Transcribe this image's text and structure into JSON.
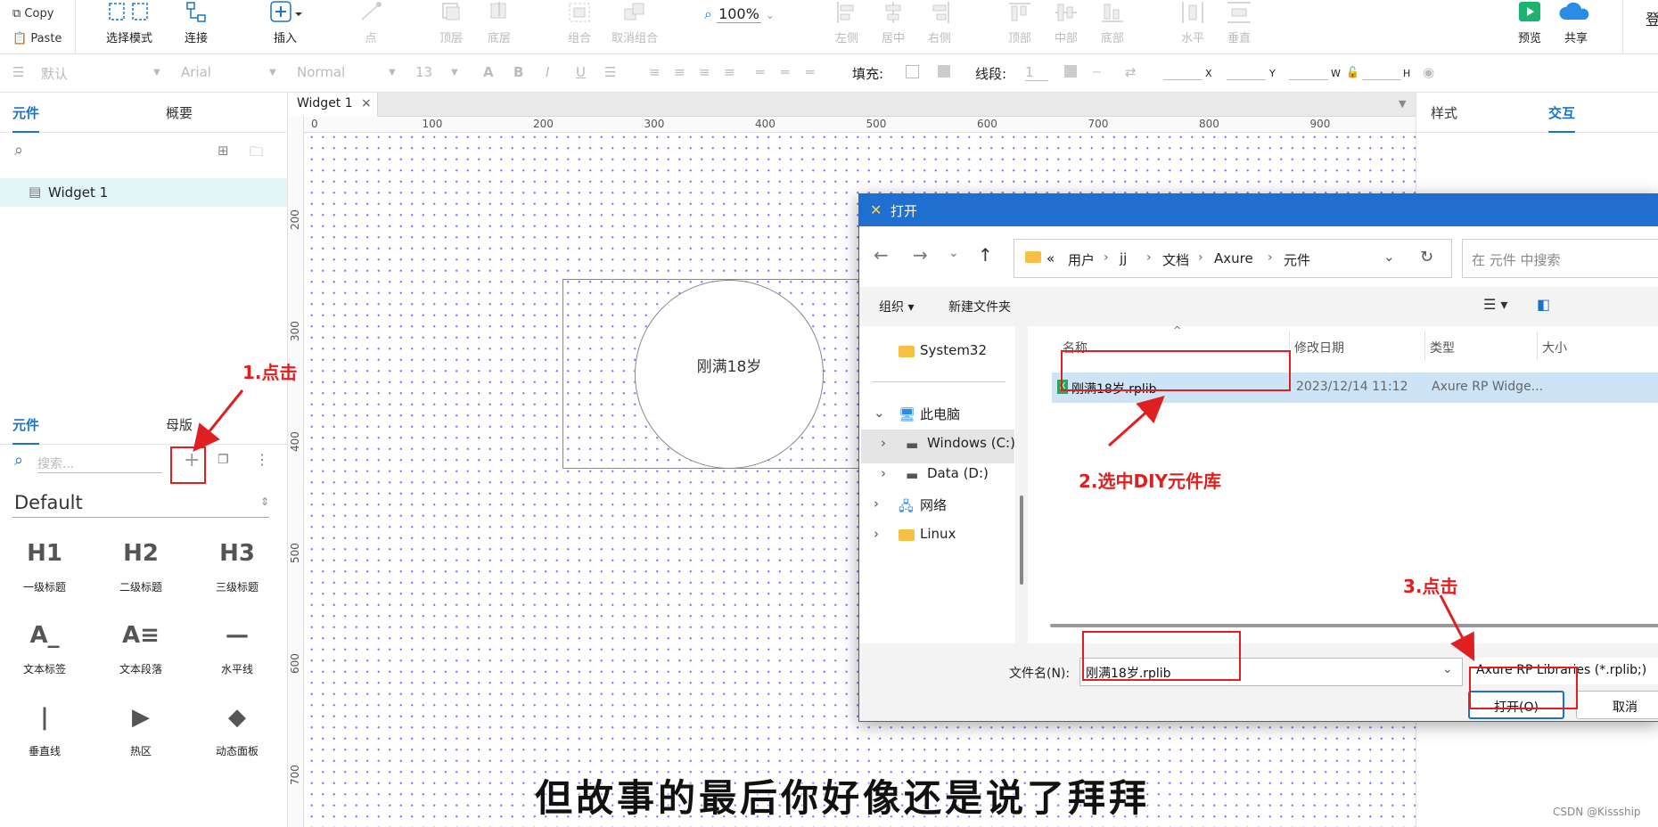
{
  "toolbar": {
    "copy": "Copy",
    "paste": "Paste",
    "items": [
      "选择模式",
      "连接",
      "插入",
      "点",
      "顶层",
      "底层",
      "组合",
      "取消组合",
      "左侧",
      "居中",
      "右侧",
      "顶部",
      "中部",
      "底部",
      "水平",
      "垂直",
      "预览",
      "共享",
      "登"
    ],
    "zoom": "100%"
  },
  "formatbar": {
    "style_default": "默认",
    "font": "Arial",
    "weight": "Normal",
    "size": "13",
    "fill_label": "填充:",
    "line_label": "线段:",
    "line_value": "1",
    "coords": [
      "X",
      "Y",
      "W",
      "H"
    ]
  },
  "left_panel": {
    "top_tabs": [
      "元件",
      "概要"
    ],
    "pages": [
      "Widget 1"
    ],
    "bottom_tabs": [
      "元件",
      "母版"
    ],
    "search_placeholder": "搜索...",
    "library": "Default",
    "widgets": [
      {
        "icon": "H1",
        "label": "一级标题"
      },
      {
        "icon": "H2",
        "label": "二级标题"
      },
      {
        "icon": "H3",
        "label": "三级标题"
      },
      {
        "icon": "A_",
        "label": "文本标签"
      },
      {
        "icon": "A≡",
        "label": "文本段落"
      },
      {
        "icon": "—",
        "label": "水平线"
      },
      {
        "icon": "|",
        "label": "垂直线"
      },
      {
        "icon": "▶",
        "label": "热区"
      },
      {
        "icon": "◆",
        "label": "动态面板"
      }
    ]
  },
  "canvas": {
    "tab": "Widget 1",
    "ruler_x": [
      "0",
      "100",
      "200",
      "300",
      "400",
      "500",
      "600",
      "700",
      "800",
      "900"
    ],
    "ruler_y": [
      "200",
      "300",
      "400",
      "500",
      "600",
      "700"
    ],
    "circle_text": "刚满18岁"
  },
  "right_panel": {
    "tabs": [
      "样式",
      "交互"
    ]
  },
  "dialog": {
    "title": "打开",
    "path": [
      "«",
      "用户",
      "jj",
      "文档",
      "Axure",
      "元件"
    ],
    "search_placeholder": "在 元件 中搜索",
    "organize": "组织 ▾",
    "new_folder": "新建文件夹",
    "tree": [
      "System32",
      "此电脑",
      "Windows (C:)",
      "Data (D:)",
      "网络",
      "Linux"
    ],
    "columns": [
      "名称",
      "修改日期",
      "类型",
      "大小"
    ],
    "files": [
      {
        "name": "刚满18岁.rplib",
        "date": "2023/12/14 11:12",
        "type": "Axure RP Widge..."
      }
    ],
    "filename_label": "文件名(N):",
    "filename": "刚满18岁.rplib",
    "filetype": "Axure RP Libraries (*.rplib;)",
    "open": "打开(O)",
    "cancel": "取消"
  },
  "annotations": [
    "1.点击",
    "2.选中DIY元件库",
    "3.点击"
  ],
  "caption": "但故事的最后你好像还是说了拜拜",
  "watermark": "CSDN @Kissship"
}
